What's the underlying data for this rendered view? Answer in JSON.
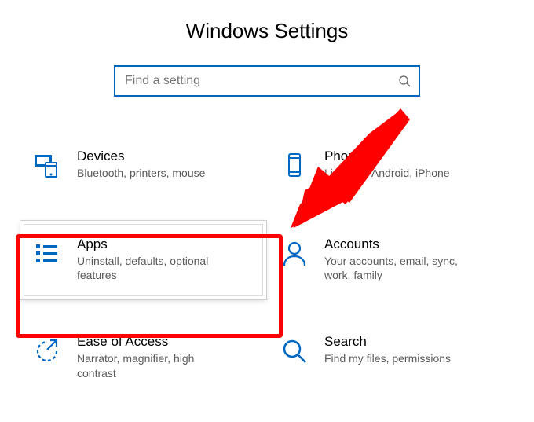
{
  "title": "Windows Settings",
  "search": {
    "placeholder": "Find a setting",
    "value": ""
  },
  "tiles": {
    "devices": {
      "title": "Devices",
      "desc": "Bluetooth, printers, mouse"
    },
    "phone": {
      "title": "Phone",
      "desc": "Link your Android, iPhone"
    },
    "apps": {
      "title": "Apps",
      "desc": "Uninstall, defaults, optional features"
    },
    "accounts": {
      "title": "Accounts",
      "desc": "Your accounts, email, sync, work, family"
    },
    "ease": {
      "title": "Ease of Access",
      "desc": "Narrator, magnifier, high contrast"
    },
    "search": {
      "title": "Search",
      "desc": "Find my files, permissions"
    }
  },
  "annotation": {
    "target": "apps",
    "color": "#ff0000"
  }
}
